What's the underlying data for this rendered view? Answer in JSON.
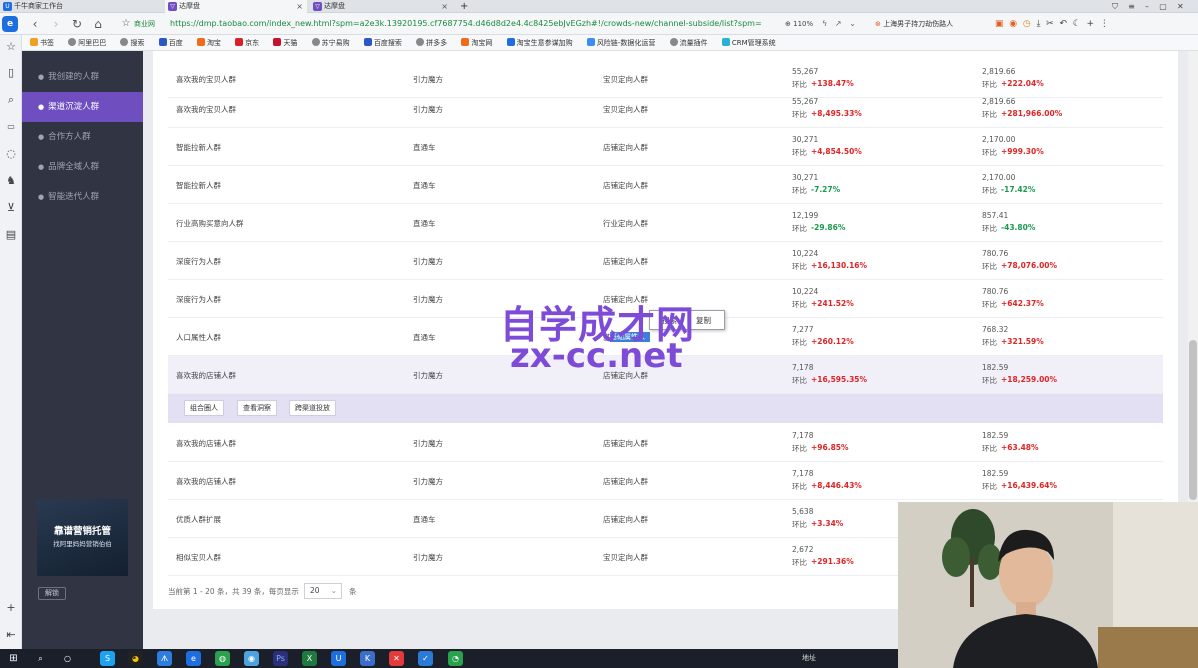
{
  "browser": {
    "tabs": [
      {
        "label": "千牛商家工作台",
        "color": "#1e6ee0"
      },
      {
        "label": "达摩盘",
        "color": "#6f4fc0"
      },
      {
        "label": "达摩盘",
        "color": "#6f4fc0"
      }
    ],
    "new_tab": "+",
    "url": "https://dmp.taobao.com/index_new.html?spm=a2e3k.13920195.cf7687754.d46d8d2e4.4c8425ebJvEGzh#!/crowds-new/channel-subside/list?spm=",
    "secure_label": "商业网",
    "zoom": "110%",
    "search_placeholder": "上海男子持刀劫伤路人",
    "bookmarks": [
      "书签",
      "阿里巴巴",
      "搜索",
      "百度",
      "淘宝",
      "京东",
      "天猫",
      "苏宁易购",
      "百度搜索",
      "拼多多",
      "淘宝网",
      "淘宝生意参谋加购",
      "风险链-数据化运营",
      "流量插件",
      "CRM管理系统"
    ]
  },
  "sidebar": {
    "items": [
      {
        "label": "我创建的人群",
        "icon": "user-icon"
      },
      {
        "label": "渠道沉淀人群",
        "icon": "user-icon"
      },
      {
        "label": "合作方人群",
        "icon": "user-icon"
      },
      {
        "label": "品牌全域人群",
        "icon": "user-icon"
      },
      {
        "label": "智能迭代人群",
        "icon": "user-icon"
      }
    ],
    "active_index": 1,
    "ad": {
      "title": "靠谱营销托管",
      "subtitle": "找阿里妈妈营销伯伯"
    },
    "unlock_label": "解锁"
  },
  "table": {
    "rows": [
      {
        "name": "喜欢我的宝贝人群",
        "channel": "引力魔方",
        "type": "宝贝定向人群",
        "v1": "55,267",
        "r1": "+138.47%",
        "d1": "up",
        "v2": "2,819.66",
        "r2": "+222.04%",
        "d2": "up"
      },
      {
        "name": "喜欢我的宝贝人群",
        "channel": "引力魔方",
        "type": "宝贝定向人群",
        "v1": "55,267",
        "r1": "+8,495.33%",
        "d1": "up",
        "v2": "2,819.66",
        "r2": "+281,966.00%",
        "d2": "up"
      },
      {
        "name": "智能拉新人群",
        "channel": "直通车",
        "type": "店铺定向人群",
        "v1": "30,271",
        "r1": "+4,854.50%",
        "d1": "up",
        "v2": "2,170.00",
        "r2": "+999.30%",
        "d2": "up"
      },
      {
        "name": "智能拉新人群",
        "channel": "直通车",
        "type": "店铺定向人群",
        "v1": "30,271",
        "r1": "-7.27%",
        "d1": "dn",
        "v2": "2,170.00",
        "r2": "-17.42%",
        "d2": "dn"
      },
      {
        "name": "行业高购买意向人群",
        "channel": "直通车",
        "type": "行业定向人群",
        "v1": "12,199",
        "r1": "-29.86%",
        "d1": "dn",
        "v2": "857.41",
        "r2": "-43.80%",
        "d2": "dn"
      },
      {
        "name": "深度行为人群",
        "channel": "引力魔方",
        "type": "店铺定向人群",
        "v1": "10,224",
        "r1": "+16,130.16%",
        "d1": "up",
        "v2": "780.76",
        "r2": "+78,076.00%",
        "d2": "up"
      },
      {
        "name": "深度行为人群",
        "channel": "引力魔方",
        "type": "店铺定向人群",
        "v1": "10,224",
        "r1": "+241.52%",
        "d1": "up",
        "v2": "780.76",
        "r2": "+642.37%",
        "d2": "up"
      },
      {
        "name": "人口属性人群",
        "channel": "直通车",
        "type": "基础属性人群",
        "v1": "7,277",
        "r1": "+260.12%",
        "d1": "up",
        "v2": "768.32",
        "r2": "+321.59%",
        "d2": "up"
      },
      {
        "name": "喜欢我的店铺人群",
        "channel": "引力魔方",
        "type": "店铺定向人群",
        "v1": "7,178",
        "r1": "+16,595.35%",
        "d1": "up",
        "v2": "182.59",
        "r2": "+18,259.00%",
        "d2": "up"
      },
      {
        "name": "喜欢我的店铺人群",
        "channel": "引力魔方",
        "type": "店铺定向人群",
        "v1": "7,178",
        "r1": "+96.85%",
        "d1": "up",
        "v2": "182.59",
        "r2": "+63.48%",
        "d2": "up"
      },
      {
        "name": "喜欢我的店铺人群",
        "channel": "引力魔方",
        "type": "店铺定向人群",
        "v1": "7,178",
        "r1": "+8,446.43%",
        "d1": "up",
        "v2": "182.59",
        "r2": "+16,439.64%",
        "d2": "up"
      },
      {
        "name": "优质人群扩展",
        "channel": "直通车",
        "type": "店铺定向人群",
        "v1": "5,638",
        "r1": "+3.34%",
        "d1": "up",
        "v2": "",
        "r2": "",
        "d2": ""
      },
      {
        "name": "相似宝贝人群",
        "channel": "引力魔方",
        "type": "宝贝定向人群",
        "v1": "2,672",
        "r1": "+291.36%",
        "d1": "up",
        "v2": "",
        "r2": "",
        "d2": ""
      }
    ],
    "ratio_prefix": "环比",
    "actions": [
      "组合圈人",
      "查看洞察",
      "跨渠道投放"
    ]
  },
  "pager": {
    "text": "当前第 1 - 20 条，共 39 条，每页显示",
    "page_size": "20",
    "unit": "条"
  },
  "watermark": {
    "line1": "自学成才网",
    "line2": "zx-cc.net"
  },
  "context_menu": {
    "items": [
      "搜索",
      "复制"
    ],
    "selected_text": "基础属性人群"
  },
  "taskbar": {
    "clock": "地址"
  }
}
